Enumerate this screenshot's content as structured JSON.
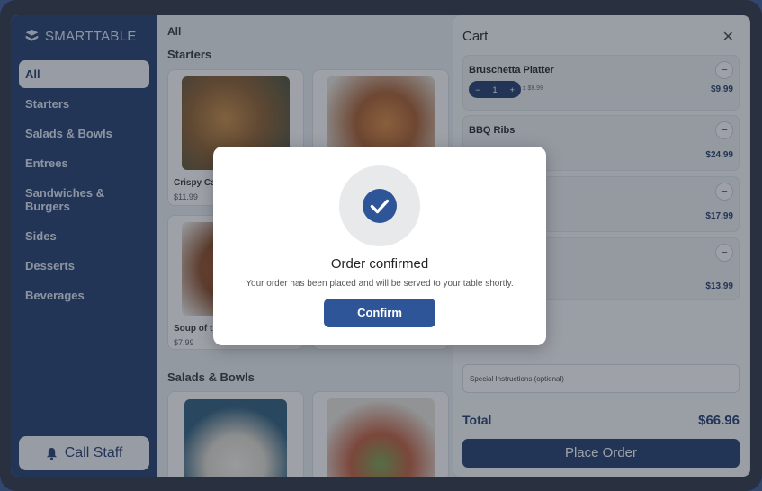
{
  "brand": {
    "name": "SMARTTABLE"
  },
  "sidebar": {
    "items": [
      {
        "label": "All"
      },
      {
        "label": "Starters"
      },
      {
        "label": "Salads & Bowls"
      },
      {
        "label": "Entrees"
      },
      {
        "label": "Sandwiches & Burgers"
      },
      {
        "label": "Sides"
      },
      {
        "label": "Desserts"
      },
      {
        "label": "Beverages"
      }
    ],
    "call_staff": "Call Staff"
  },
  "menu": {
    "breadcrumb": "All",
    "sections": [
      {
        "title": "Starters"
      },
      {
        "title": "Salads & Bowls"
      }
    ],
    "cards": [
      {
        "name": "Crispy Ca",
        "price": "$11.99"
      },
      {
        "name": "",
        "price": ""
      },
      {
        "name": "Soup of t",
        "price": "$7.99"
      },
      {
        "name": "",
        "price": ""
      }
    ]
  },
  "cart": {
    "title": "Cart",
    "items": [
      {
        "name": "Bruschetta Platter",
        "qty": "1",
        "unit": "x $9.99",
        "total": "$9.99"
      },
      {
        "name": "BBQ Ribs",
        "qty": "",
        "unit": "",
        "total": "$24.99"
      },
      {
        "name": "",
        "qty": "",
        "unit": "",
        "total": "$17.99"
      },
      {
        "name": "",
        "qty": "",
        "unit": "",
        "total": "$13.99"
      }
    ],
    "special_placeholder": "Special Instructions (optional)",
    "total_label": "Total",
    "total_value": "$66.96",
    "place_order": "Place Order"
  },
  "modal": {
    "title": "Order confirmed",
    "message": "Your order has been placed and will be served to your table shortly.",
    "button": "Confirm"
  },
  "colors": {
    "brand_navy": "#1f3a6b",
    "button_blue": "#2e5597",
    "sidebar_bg": "#1f3a6b"
  },
  "icons": {
    "close": "close-icon",
    "bell": "bell-icon",
    "check": "check-icon",
    "minus": "minus-icon",
    "plus": "plus-icon"
  }
}
